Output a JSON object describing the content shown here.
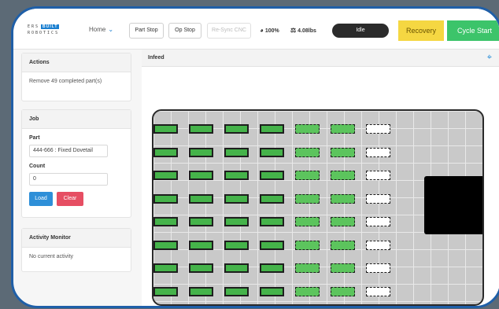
{
  "brand": {
    "line1": "ERS",
    "box1": "BUILT",
    "line2": "ROBOTICS"
  },
  "nav": {
    "home_label": "Home"
  },
  "toolbar": {
    "part_stop": "Part Stop",
    "op_stop": "Op Stop",
    "resync": "Re-Sync CNC",
    "speed": "100%",
    "weight": "4.08lbs",
    "status": "Idle",
    "recovery": "Recovery",
    "cycle_start": "Cycle Start"
  },
  "actions": {
    "title": "Actions",
    "message": "Remove 49 completed part(s)"
  },
  "job": {
    "title": "Job",
    "part_label": "Part",
    "part_value": "444-666 : Fixed Dovetail",
    "count_label": "Count",
    "count_value": "0",
    "load_label": "Load",
    "clear_label": "Clear"
  },
  "activity": {
    "title": "Activity Monitor",
    "message": "No current activity"
  },
  "infeed": {
    "title": "Infeed",
    "rows": 8,
    "columns": [
      "full",
      "full",
      "full",
      "full",
      "part",
      "part",
      "empty"
    ],
    "last_row_cut": true
  },
  "colors": {
    "accent": "#1a7fd0",
    "recovery": "#f5d742",
    "cycle_start": "#3cc46a",
    "load": "#2e8fd8",
    "clear": "#e64e63",
    "part_fill": "#45b34a"
  }
}
